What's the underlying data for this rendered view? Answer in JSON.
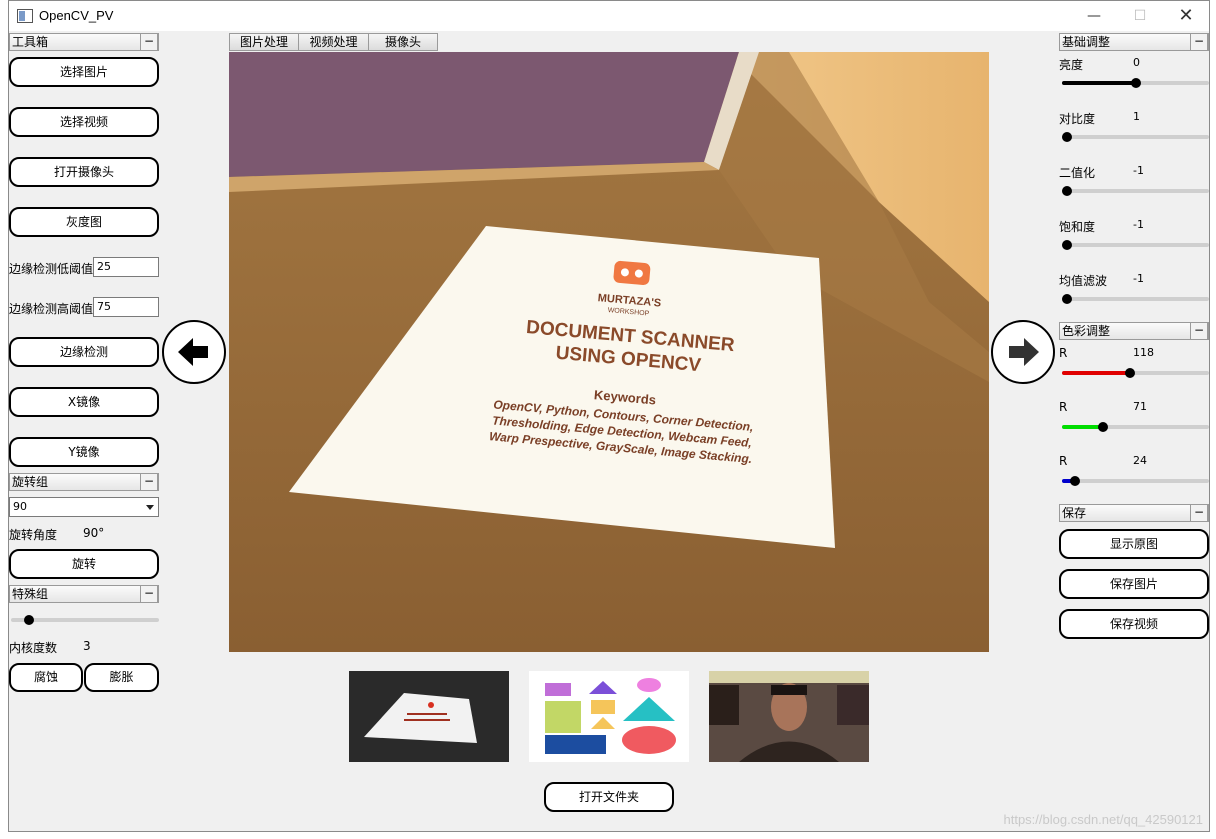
{
  "window": {
    "title": "OpenCV_PV"
  },
  "toolbox": {
    "header": "工具箱",
    "buttons": [
      "选择图片",
      "选择视频",
      "打开摄像头",
      "灰度图"
    ],
    "edge_low_label": "边缘检测低阈值",
    "edge_low_value": "25",
    "edge_high_label": "边缘检测高阈值",
    "edge_high_value": "75",
    "edge_button": "边缘检测",
    "mirror_x": "X镜像",
    "mirror_y": "Y镜像"
  },
  "rotate_group": {
    "header": "旋转组",
    "selected": "90",
    "angle_label": "旋转角度",
    "angle_value": "90°",
    "rotate_button": "旋转"
  },
  "special_group": {
    "header": "特殊组",
    "kernel_label": "内核度数",
    "kernel_value": "3",
    "kernel_level": 0.12,
    "erode_button": "腐蚀",
    "dilate_button": "膨胀"
  },
  "tabs": [
    "图片处理",
    "视频处理",
    "摄像头"
  ],
  "document": {
    "brand": "MURTAZA'S",
    "brand_sub": "WORKSHOP",
    "title1": "DOCUMENT SCANNER",
    "title2": "USING OPENCV",
    "keywords_title": "Keywords",
    "kw1": "OpenCV, Python, Contours, Corner Detection,",
    "kw2": "Thresholding, Edge Detection, Webcam Feed,",
    "kw3": "Warp Prespective, GrayScale, Image Stacking."
  },
  "basic_adjust": {
    "header": "基础调整",
    "sliders": [
      {
        "label": "亮度",
        "value": "0",
        "level": 0.5
      },
      {
        "label": "对比度",
        "value": "1",
        "level": 0.0
      },
      {
        "label": "二值化",
        "value": "-1",
        "level": 0.0
      },
      {
        "label": "饱和度",
        "value": "-1",
        "level": 0.0
      },
      {
        "label": "均值滤波",
        "value": "-1",
        "level": 0.0
      }
    ]
  },
  "color_adjust": {
    "header": "色彩调整",
    "sliders": [
      {
        "label": "R",
        "value": "118",
        "level": 0.46,
        "color": "#e00000"
      },
      {
        "label": "R",
        "value": "71",
        "level": 0.28,
        "color": "#00dd00"
      },
      {
        "label": "R",
        "value": "24",
        "level": 0.09,
        "color": "#0000cc"
      }
    ]
  },
  "save_group": {
    "header": "保存",
    "buttons": [
      "显示原图",
      "保存图片",
      "保存视频"
    ]
  },
  "open_folder": "打开文件夹",
  "watermark": "https://blog.csdn.net/qq_42590121"
}
